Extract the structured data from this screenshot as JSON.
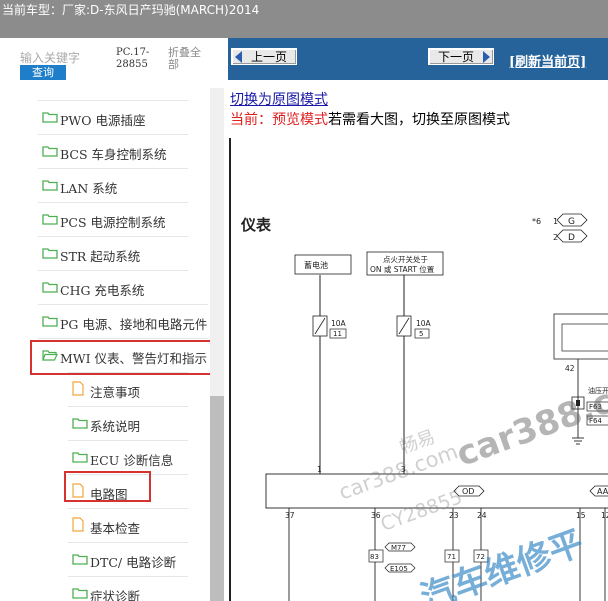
{
  "header": {
    "vehicle_label": "当前车型：",
    "vehicle_value": "厂家:D-东风日产玛驰(MARCH)2014"
  },
  "sidebar": {
    "search_placeholder": "输入关键字",
    "search_button": "查询",
    "pc_code": "PC.17-28855",
    "collapse_all": "折叠全部",
    "items": [
      {
        "label": "PWO 电源插座",
        "type": "folder"
      },
      {
        "label": "BCS 车身控制系统",
        "type": "folder"
      },
      {
        "label": "LAN 系统",
        "type": "folder"
      },
      {
        "label": "PCS 电源控制系统",
        "type": "folder"
      },
      {
        "label": "STR 起动系统",
        "type": "folder"
      },
      {
        "label": "CHG 充电系统",
        "type": "folder"
      },
      {
        "label": "PG 电源、接地和电路元件",
        "type": "folder"
      },
      {
        "label": "MWI 仪表、警告灯和指示",
        "type": "folder-open"
      },
      {
        "label": "注意事项",
        "type": "doc"
      },
      {
        "label": "系统说明",
        "type": "folder"
      },
      {
        "label": "ECU 诊断信息",
        "type": "folder"
      },
      {
        "label": "电路图",
        "type": "doc"
      },
      {
        "label": "基本检查",
        "type": "doc"
      },
      {
        "label": "DTC/ 电路诊断",
        "type": "folder"
      },
      {
        "label": "症状诊断",
        "type": "folder"
      }
    ]
  },
  "content": {
    "prev_page": "上一页",
    "next_page": "下一页",
    "refresh": "[刷新当前页]",
    "switch_link": "切换为原图模式",
    "mode_prefix": "当前：",
    "mode_name": "预览模式",
    "mode_suffix": "若需看大图，切换至原图模式"
  },
  "diagram": {
    "title": "仪表",
    "battery_box": "蓄电池",
    "ignition_box_line1": "点火开关处于",
    "ignition_box_line2": "ON 或 START 位置",
    "note_mark": "*6",
    "connector_1": "1",
    "connector_1_letter": "G",
    "connector_2": "2",
    "connector_2_letter": "D",
    "fuse_1_rating": "10A",
    "fuse_1_no": "11",
    "fuse_2_rating": "10A",
    "fuse_2_no": "5",
    "pin_42": "42",
    "oil_label": "油压开",
    "f63": "F63",
    "f64": "F64",
    "pin_1": "1",
    "pin_3": "3",
    "od": "OD",
    "aa": "AA",
    "pin_37": "37",
    "pin_36": "36",
    "pin_23": "23",
    "pin_24": "24",
    "pin_15": "15",
    "pin_12": "12",
    "m77": "M77",
    "e105": "E105",
    "p83": "83",
    "p71": "71",
    "p72": "72"
  },
  "watermarks": {
    "w1": "畅易",
    "w2": "car388.com",
    "w3": "CY28855",
    "w4": "car388.c",
    "w5": "汽车维修平"
  },
  "colors": {
    "accent": "#1f7ec9",
    "nav": "#26639a",
    "highlight": "#d6322f",
    "folder": "#4caf50",
    "doc": "#f0a63a"
  }
}
